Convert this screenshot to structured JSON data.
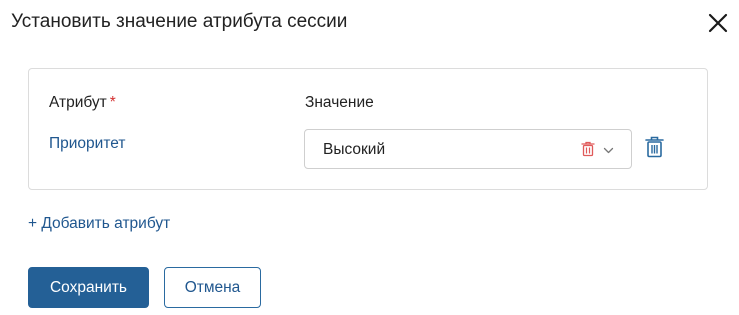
{
  "dialog": {
    "title": "Установить значение атрибута сессии",
    "close_icon": "close-icon"
  },
  "table": {
    "attribute_header": "Атрибут",
    "required_mark": "*",
    "value_header": "Значение",
    "rows": [
      {
        "attribute": "Приоритет",
        "value": "Высокий",
        "clear_icon": "trash-icon",
        "dropdown_icon": "chevron-down-icon",
        "delete_icon": "trash-icon"
      }
    ]
  },
  "actions": {
    "add_attribute": "+ Добавить атрибут",
    "save": "Сохранить",
    "cancel": "Отмена"
  },
  "colors": {
    "primary": "#246096",
    "link": "#20578f",
    "required": "#d32f2f",
    "clear_icon": "#e05a5a",
    "border": "#dcdcdc"
  }
}
